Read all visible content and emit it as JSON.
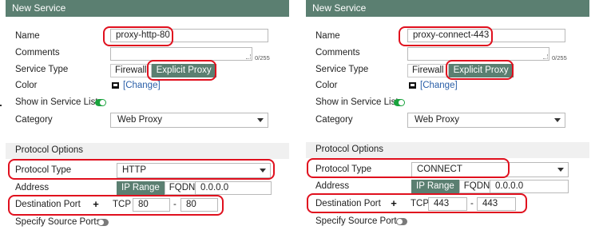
{
  "left": {
    "header": "New Service",
    "name_label": "Name",
    "name_value": "proxy-http-80",
    "comments_label": "Comments",
    "comments_counter": "0/255",
    "service_type_label": "Service Type",
    "service_type_options": [
      "Firewall",
      "Explicit Proxy"
    ],
    "color_label": "Color",
    "color_change": "[Change]",
    "show_in_list_label": "Show in Service List",
    "category_label": "Category",
    "category_value": "Web Proxy",
    "protocol_options_header": "Protocol Options",
    "protocol_type_label": "Protocol Type",
    "protocol_type_value": "HTTP",
    "address_label": "Address",
    "address_options": [
      "IP Range",
      "FQDN"
    ],
    "address_value": "0.0.0.0",
    "dest_port_label": "Destination Port",
    "plus": "+",
    "tcp_label": "TCP",
    "port_low": "80",
    "dash": "-",
    "port_high": "80",
    "specify_source_label": "Specify Source Ports"
  },
  "right": {
    "header": "New Service",
    "name_label": "Name",
    "name_value": "proxy-connect-443",
    "comments_label": "Comments",
    "comments_counter": "0/255",
    "service_type_label": "Service Type",
    "service_type_options": [
      "Firewall",
      "Explicit Proxy"
    ],
    "color_label": "Color",
    "color_change": "[Change]",
    "show_in_list_label": "Show in Service List",
    "category_label": "Category",
    "category_value": "Web Proxy",
    "protocol_options_header": "Protocol Options",
    "protocol_type_label": "Protocol Type",
    "protocol_type_value": "CONNECT",
    "address_label": "Address",
    "address_options": [
      "IP Range",
      "FQDN"
    ],
    "address_value": "0.0.0.0",
    "dest_port_label": "Destination Port",
    "plus": "+",
    "tcp_label": "TCP",
    "port_low": "443",
    "dash": "-",
    "port_high": "443",
    "specify_source_label": "Specify Source Ports"
  },
  "colors": {
    "header_bg": "#5b7f71",
    "active_segment": "#5b7f71",
    "toggle_on": "#1aa33d",
    "toggle_off": "#7a7a7a",
    "link": "#2a5fa8",
    "annotation": "#e0101e"
  },
  "icons": {
    "color_swatch": "color-swatch-icon",
    "dropdown": "chevron-down-icon",
    "add": "plus-icon"
  }
}
